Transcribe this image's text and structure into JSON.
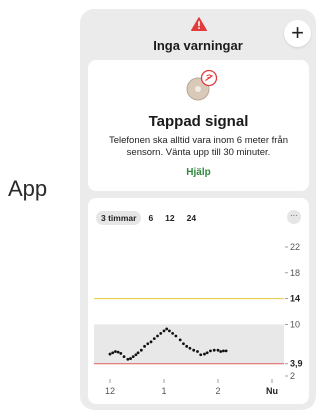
{
  "app_label": "App",
  "header": {
    "title": "Inga varningar",
    "plus_label": "+"
  },
  "signal_card": {
    "title": "Tappad signal",
    "description": "Telefonen ska alltid vara inom 6 meter från sensorn. Vänta upp till 30 minuter.",
    "help_label": "Hjälp"
  },
  "range_tabs": [
    {
      "label": "3 timmar",
      "active": true
    },
    {
      "label": "6",
      "active": false
    },
    {
      "label": "12",
      "active": false
    },
    {
      "label": "24",
      "active": false
    }
  ],
  "more_label": "···",
  "colors": {
    "warning": "#e23b3b",
    "help": "#2e8b3e",
    "high_line": "#e8c93a",
    "low_line": "#e05a5a",
    "target_band": "#e8e8e8"
  },
  "chart_data": {
    "type": "scatter",
    "ylim": [
      2,
      22
    ],
    "y_ticks": [
      "22",
      "18",
      "14",
      "10",
      "3,9",
      "2"
    ],
    "x_labels": [
      "12",
      "1",
      "2",
      "Nu"
    ],
    "x_label_positions": [
      0,
      1,
      2,
      3
    ],
    "high_threshold": 14,
    "low_threshold": 3.9,
    "target_range": [
      3.9,
      10
    ],
    "points": [
      [
        0.0,
        5.4
      ],
      [
        0.05,
        5.6
      ],
      [
        0.1,
        5.8
      ],
      [
        0.15,
        5.7
      ],
      [
        0.2,
        5.5
      ],
      [
        0.26,
        5.0
      ],
      [
        0.33,
        4.6
      ],
      [
        0.38,
        4.7
      ],
      [
        0.43,
        5.0
      ],
      [
        0.48,
        5.3
      ],
      [
        0.52,
        5.6
      ],
      [
        0.58,
        6.0
      ],
      [
        0.64,
        6.6
      ],
      [
        0.7,
        7.0
      ],
      [
        0.76,
        7.3
      ],
      [
        0.82,
        7.8
      ],
      [
        0.88,
        8.2
      ],
      [
        0.94,
        8.6
      ],
      [
        1.0,
        9.0
      ],
      [
        1.05,
        9.3
      ],
      [
        1.1,
        9.0
      ],
      [
        1.16,
        8.6
      ],
      [
        1.22,
        8.2
      ],
      [
        1.3,
        7.6
      ],
      [
        1.36,
        7.0
      ],
      [
        1.42,
        6.6
      ],
      [
        1.48,
        6.3
      ],
      [
        1.55,
        6.0
      ],
      [
        1.62,
        5.8
      ],
      [
        1.68,
        5.3
      ],
      [
        1.75,
        5.4
      ],
      [
        1.8,
        5.6
      ],
      [
        1.86,
        5.9
      ],
      [
        1.93,
        6.0
      ],
      [
        2.0,
        6.0
      ],
      [
        2.05,
        5.8
      ],
      [
        2.1,
        5.9
      ],
      [
        2.15,
        5.9
      ]
    ]
  }
}
